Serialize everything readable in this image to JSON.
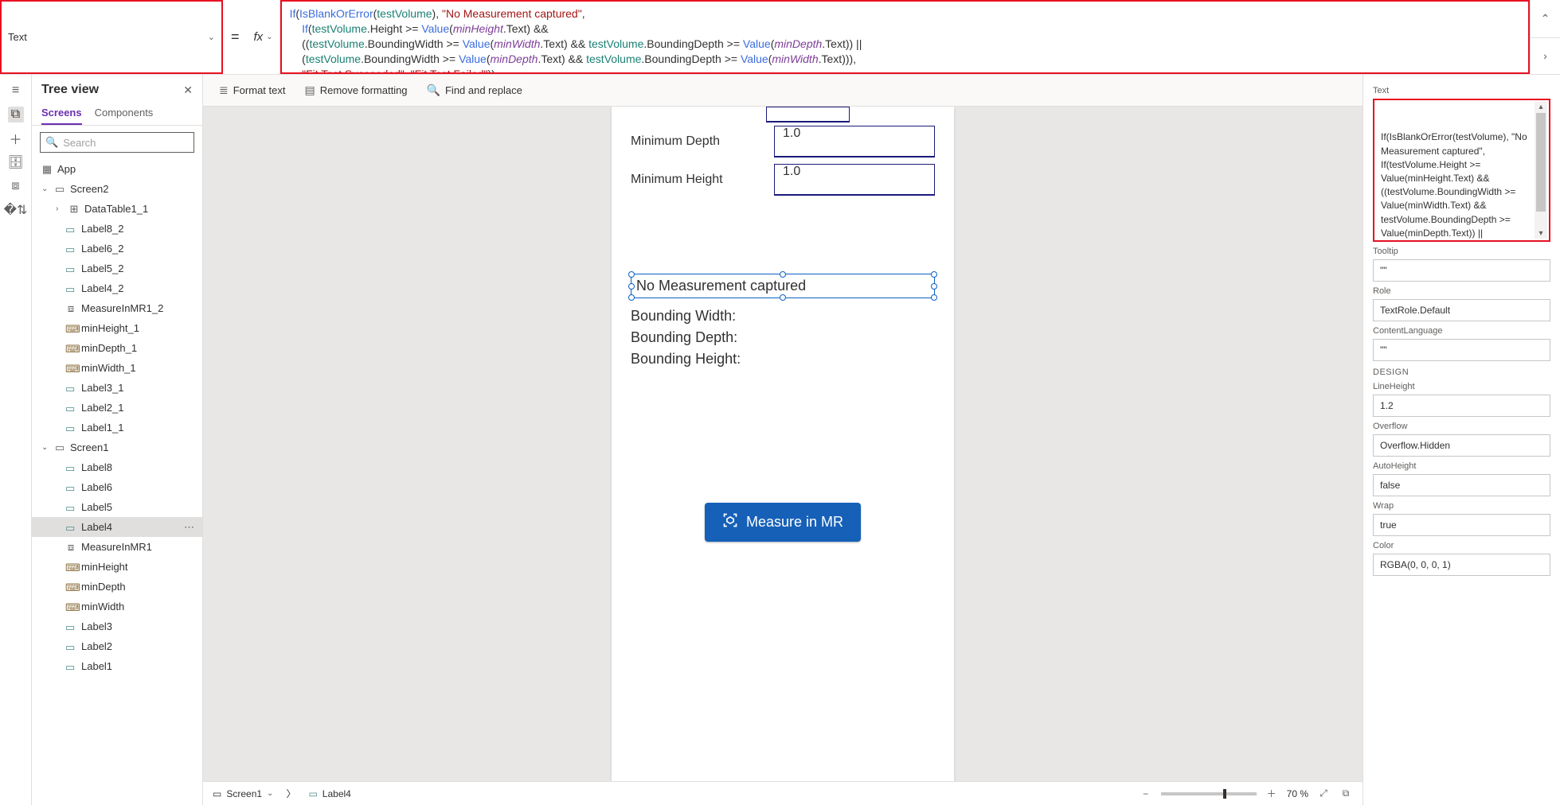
{
  "property_selector": "Text",
  "formula_tokens": [
    {
      "line": 0,
      "parts": [
        {
          "t": "If",
          "c": "c-kw"
        },
        {
          "t": "(",
          "c": "c-op"
        },
        {
          "t": "IsBlankOrError",
          "c": "c-kw"
        },
        {
          "t": "(",
          "c": "c-op"
        },
        {
          "t": "testVolume",
          "c": "c-var"
        },
        {
          "t": "), ",
          "c": "c-op"
        },
        {
          "t": "\"No Measurement captured\"",
          "c": "c-str"
        },
        {
          "t": ",",
          "c": "c-op"
        }
      ]
    },
    {
      "line": 1,
      "parts": [
        {
          "t": "    If",
          "c": "c-kw"
        },
        {
          "t": "(",
          "c": "c-op"
        },
        {
          "t": "testVolume",
          "c": "c-var"
        },
        {
          "t": ".Height >= ",
          "c": "c-prop"
        },
        {
          "t": "Value",
          "c": "c-fn"
        },
        {
          "t": "(",
          "c": "c-op"
        },
        {
          "t": "minHeight",
          "c": "c-ident"
        },
        {
          "t": ".Text) &&",
          "c": "c-prop"
        }
      ]
    },
    {
      "line": 2,
      "parts": [
        {
          "t": "    ((",
          "c": "c-op"
        },
        {
          "t": "testVolume",
          "c": "c-var"
        },
        {
          "t": ".BoundingWidth >= ",
          "c": "c-prop"
        },
        {
          "t": "Value",
          "c": "c-fn"
        },
        {
          "t": "(",
          "c": "c-op"
        },
        {
          "t": "minWidth",
          "c": "c-ident"
        },
        {
          "t": ".Text) && ",
          "c": "c-prop"
        },
        {
          "t": "testVolume",
          "c": "c-var"
        },
        {
          "t": ".BoundingDepth >= ",
          "c": "c-prop"
        },
        {
          "t": "Value",
          "c": "c-fn"
        },
        {
          "t": "(",
          "c": "c-op"
        },
        {
          "t": "minDepth",
          "c": "c-ident"
        },
        {
          "t": ".Text)) ||",
          "c": "c-prop"
        }
      ]
    },
    {
      "line": 3,
      "parts": [
        {
          "t": "    (",
          "c": "c-op"
        },
        {
          "t": "testVolume",
          "c": "c-var"
        },
        {
          "t": ".BoundingWidth >= ",
          "c": "c-prop"
        },
        {
          "t": "Value",
          "c": "c-fn"
        },
        {
          "t": "(",
          "c": "c-op"
        },
        {
          "t": "minDepth",
          "c": "c-ident"
        },
        {
          "t": ".Text) && ",
          "c": "c-prop"
        },
        {
          "t": "testVolume",
          "c": "c-var"
        },
        {
          "t": ".BoundingDepth >= ",
          "c": "c-prop"
        },
        {
          "t": "Value",
          "c": "c-fn"
        },
        {
          "t": "(",
          "c": "c-op"
        },
        {
          "t": "minWidth",
          "c": "c-ident"
        },
        {
          "t": ".Text))),",
          "c": "c-prop"
        }
      ]
    },
    {
      "line": 4,
      "parts": [
        {
          "t": "    ",
          "c": "c-plain"
        },
        {
          "t": "\"Fit Test Succeeded\"",
          "c": "c-str"
        },
        {
          "t": ", ",
          "c": "c-op"
        },
        {
          "t": "\"Fit Test Failed\"",
          "c": "c-str"
        },
        {
          "t": "))",
          "c": "c-op"
        }
      ]
    }
  ],
  "toolbar": {
    "format": "Format text",
    "remove": "Remove formatting",
    "find": "Find and replace"
  },
  "tree": {
    "title": "Tree view",
    "tabs": [
      "Screens",
      "Components"
    ],
    "search_placeholder": "Search",
    "app": "App",
    "items": [
      {
        "depth": 0,
        "chev": "v",
        "icon": "screen",
        "label": "Screen2"
      },
      {
        "depth": 1,
        "chev": ">",
        "icon": "table",
        "label": "DataTable1_1"
      },
      {
        "depth": 1,
        "icon": "label",
        "label": "Label8_2"
      },
      {
        "depth": 1,
        "icon": "label",
        "label": "Label6_2"
      },
      {
        "depth": 1,
        "icon": "label",
        "label": "Label5_2"
      },
      {
        "depth": 1,
        "icon": "label",
        "label": "Label4_2"
      },
      {
        "depth": 1,
        "icon": "frame",
        "label": "MeasureInMR1_2"
      },
      {
        "depth": 1,
        "icon": "input",
        "label": "minHeight_1"
      },
      {
        "depth": 1,
        "icon": "input",
        "label": "minDepth_1"
      },
      {
        "depth": 1,
        "icon": "input",
        "label": "minWidth_1"
      },
      {
        "depth": 1,
        "icon": "label",
        "label": "Label3_1"
      },
      {
        "depth": 1,
        "icon": "label",
        "label": "Label2_1"
      },
      {
        "depth": 1,
        "icon": "label",
        "label": "Label1_1"
      },
      {
        "depth": 0,
        "chev": "v",
        "icon": "screen",
        "label": "Screen1"
      },
      {
        "depth": 1,
        "icon": "label",
        "label": "Label8"
      },
      {
        "depth": 1,
        "icon": "label",
        "label": "Label6"
      },
      {
        "depth": 1,
        "icon": "label",
        "label": "Label5"
      },
      {
        "depth": 1,
        "icon": "label",
        "label": "Label4",
        "selected": true
      },
      {
        "depth": 1,
        "icon": "frame",
        "label": "MeasureInMR1"
      },
      {
        "depth": 1,
        "icon": "input",
        "label": "minHeight"
      },
      {
        "depth": 1,
        "icon": "input",
        "label": "minDepth"
      },
      {
        "depth": 1,
        "icon": "input",
        "label": "minWidth"
      },
      {
        "depth": 1,
        "icon": "label",
        "label": "Label3"
      },
      {
        "depth": 1,
        "icon": "label",
        "label": "Label2"
      },
      {
        "depth": 1,
        "icon": "label",
        "label": "Label1"
      }
    ]
  },
  "canvas": {
    "min_depth_label": "Minimum Depth",
    "min_depth_value": "1.0",
    "min_height_label": "Minimum Height",
    "min_height_value": "1.0",
    "result": "No Measurement captured",
    "bw": "Bounding Width:",
    "bd": "Bounding Depth:",
    "bh": "Bounding Height:",
    "measure_btn": "Measure in MR"
  },
  "props": {
    "text_label": "Text",
    "text_value": "If(IsBlankOrError(testVolume), \"No\nMeasurement captured\",\nIf(testVolume.Height >=\nValue(minHeight.Text) &&\n((testVolume.BoundingWidth >=\nValue(minWidth.Text) &&\ntestVolume.BoundingDepth >=\nValue(minDepth.Text)) ||\n(testVolume.BoundingWidth >=\nValue(minDepth.Text) &&",
    "tooltip_label": "Tooltip",
    "tooltip_value": "\"\"",
    "role_label": "Role",
    "role_value": "TextRole.Default",
    "lang_label": "ContentLanguage",
    "lang_value": "\"\"",
    "design": "DESIGN",
    "lineheight_label": "LineHeight",
    "lineheight_value": "1.2",
    "overflow_label": "Overflow",
    "overflow_value": "Overflow.Hidden",
    "autoheight_label": "AutoHeight",
    "autoheight_value": "false",
    "wrap_label": "Wrap",
    "wrap_value": "true",
    "color_label": "Color",
    "color_value": "RGBA(0, 0, 0, 1)"
  },
  "status": {
    "screen": "Screen1",
    "control": "Label4",
    "zoom": "70 %"
  }
}
